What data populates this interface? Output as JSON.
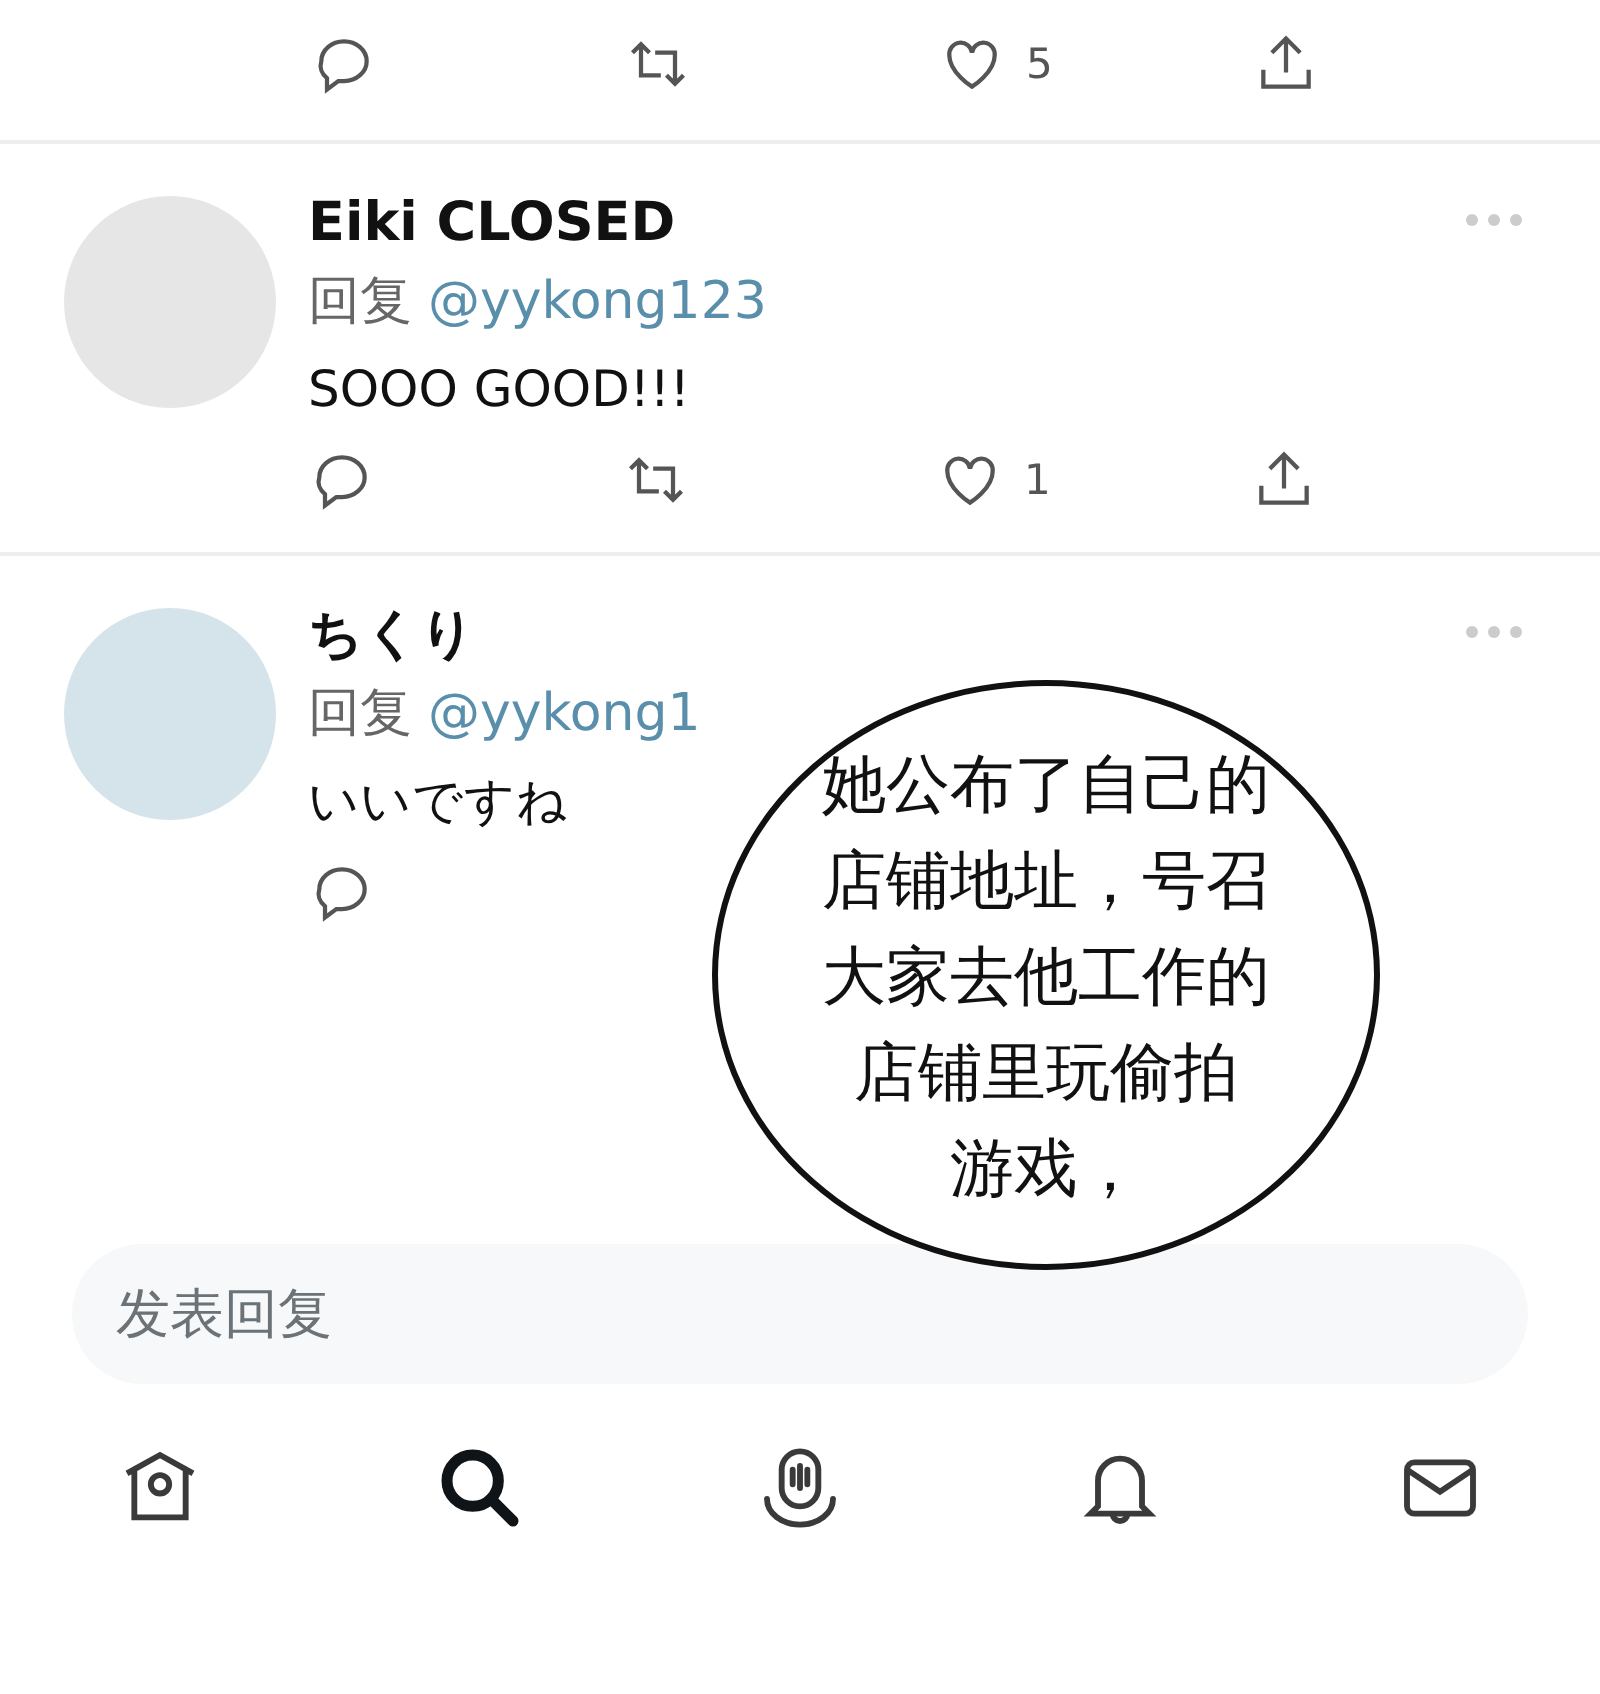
{
  "top_actions": [
    {
      "kind": "reply"
    },
    {
      "kind": "retweet"
    },
    {
      "kind": "like",
      "count": "5"
    },
    {
      "kind": "share"
    }
  ],
  "replies": [
    {
      "author": "Eiki CLOSED",
      "color": "#e6e6e6",
      "reply_label": "回复",
      "handle": "@yykong123",
      "text": "SOOO GOOD!!!",
      "actions": [
        {
          "kind": "reply"
        },
        {
          "kind": "retweet"
        },
        {
          "kind": "like",
          "count": "1"
        },
        {
          "kind": "share"
        }
      ]
    },
    {
      "author": "ちくり",
      "color": "#d5e3ea",
      "reply_label": "回复",
      "handle": "@yykong1",
      "text": "いいですね",
      "actions": [
        {
          "kind": "reply"
        }
      ]
    }
  ],
  "bubble": {
    "lines": [
      "她公布了自己的",
      "店铺地址，号召",
      "大家去他工作的",
      "店铺里玩偷拍",
      "游戏，"
    ]
  },
  "reply_field": {
    "placeholder": "发表回复"
  },
  "nav": [
    {
      "kind": "home",
      "selected": false
    },
    {
      "kind": "search",
      "selected": true
    },
    {
      "kind": "spaces",
      "selected": false
    },
    {
      "kind": "notifications",
      "selected": false
    },
    {
      "kind": "messages",
      "selected": false
    }
  ]
}
